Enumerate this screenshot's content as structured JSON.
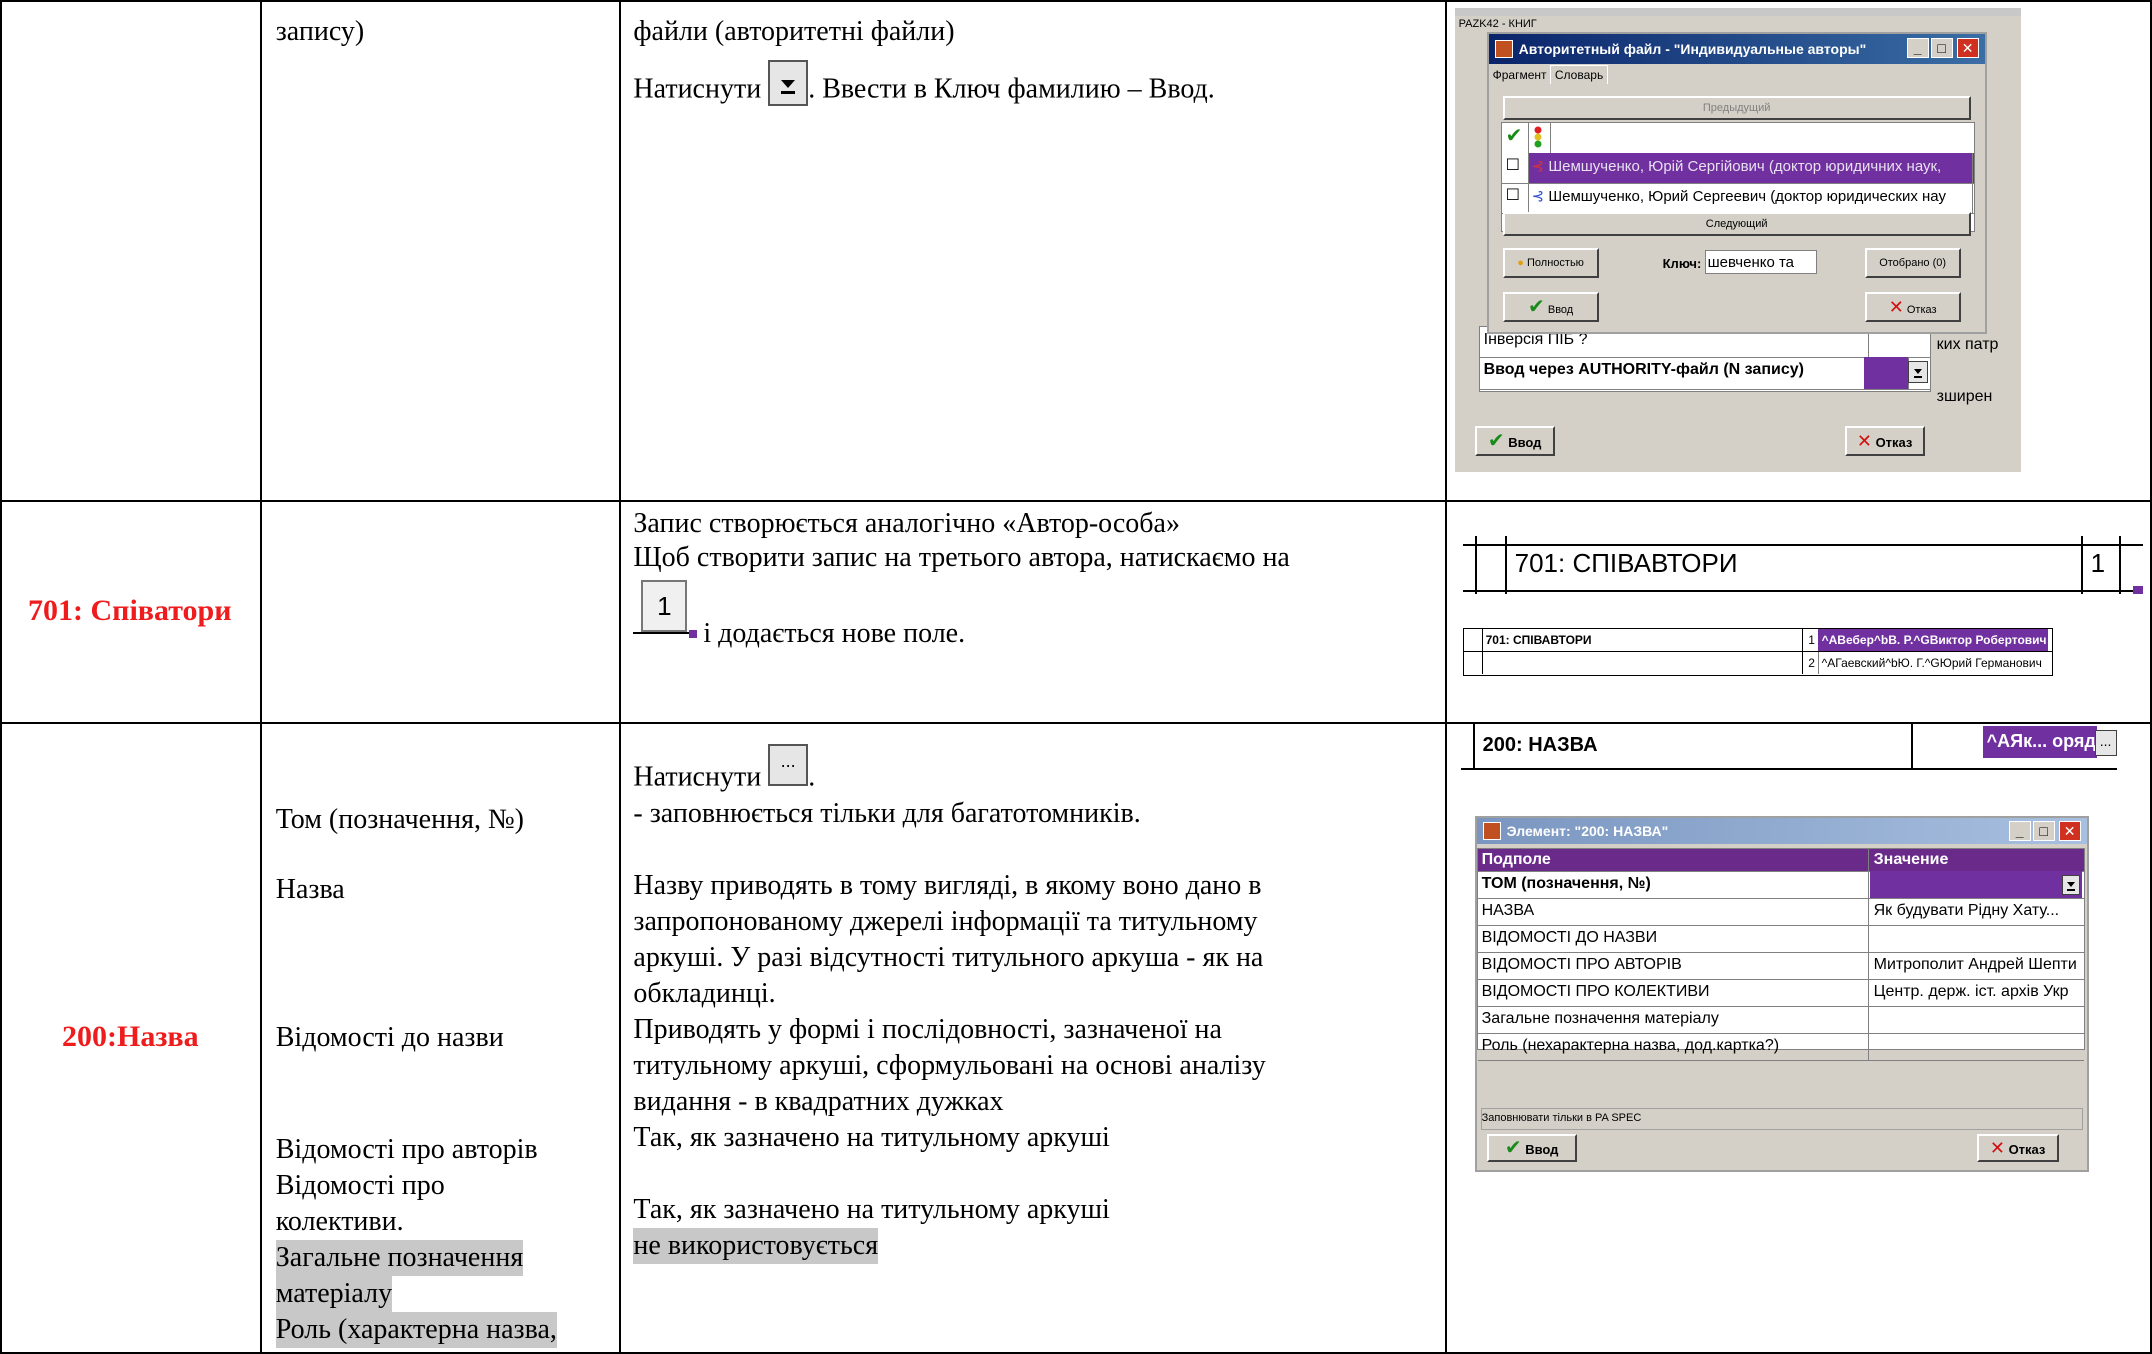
{
  "rows": [
    {
      "field": "",
      "sub": [
        "запису)"
      ],
      "desc": [
        "файли (авторитетні файли)",
        "Натиснути",
        ". Ввести в Ключ фамилию – Ввод."
      ]
    },
    {
      "field": "701: Співатори",
      "desc": [
        "Запис створюється аналогічно «Автор-особа»",
        "Щоб створити запис на третього автора, натискаємо на",
        "1",
        "і додається нове поле."
      ]
    },
    {
      "field": "200:Назва",
      "sub": [
        "Том (позначення, №)",
        "Назва",
        "Відомості до назви",
        "Відомості про авторів",
        "Відомості про",
        "колективи.",
        "Загальне позначення",
        "матеріалу",
        "Роль (характерна назва,"
      ],
      "desc": [
        "Натиснути",
        ".",
        "- заповнюється тільки для багатотомників.",
        "Назву приводять в тому вигляді, в якому воно дано в",
        "запропонованому  джерелі інформації та титульному",
        "аркуші. У разі відсутності титульного аркуша - як на",
        "обкладинці.",
        "Приводять у формі і послідовності, зазначеної на",
        "титульному аркуші, сформульовані на основі аналізу",
        "видання - в квадратних дужках",
        "Так, як зазначено на титульному аркуші",
        "Так, як зазначено на титульному аркуші",
        "не використовується"
      ]
    }
  ],
  "auth_window": {
    "bg_title": "PAZK42 - КНИГ",
    "title": "Авторитетный файл - \"Индивидуальные авторы\"",
    "tabs": [
      "Фрагмент",
      "Словарь"
    ],
    "prev": "Предыдущий",
    "next": "Следующий",
    "items": [
      "Шемшученко, Юрій Сергійович (доктор юридичних наук,",
      "Шемшученко, Юрий Сергеевич (доктор юридических нау"
    ],
    "full_btn": "Полностью",
    "key_label": "Ключ:",
    "key_value": "шевченко та",
    "selected_btn": "Отобрано (0)",
    "ok": "Ввод",
    "cancel": "Отказ",
    "bg_rows": [
      "Інверсія ПІБ ?",
      "Ввод через AUTHORITY-файл (N запису)"
    ],
    "bg_side": [
      "ких патр",
      "зширен"
    ],
    "bg_ok": "Ввод",
    "bg_cancel": "Отказ"
  },
  "coauthors": {
    "big_label": "701: СПІВАВТОРИ",
    "big_num": "1",
    "small_label": "701: СПІВАВТОРИ",
    "small_rows": [
      {
        "num": "1",
        "value": "^AВебер^bB. P.^GВиктор Робертович"
      },
      {
        "num": "2",
        "value": "^AГаевский^bЮ. Г.^GЮрий Германович"
      }
    ]
  },
  "title_field": {
    "label": "200: НАЗВА",
    "value": "^AЯк... оряд. Р.",
    "more": "..."
  },
  "element_window": {
    "title": "Элемент: \"200: НАЗВА\"",
    "col1": "Подполе",
    "col2": "Значение",
    "rows": [
      {
        "name": "ТОМ (позначення, №)",
        "value": ""
      },
      {
        "name": "НАЗВА",
        "value": "Як будувати Рідну Хату..."
      },
      {
        "name": "ВІДОМОСТІ ДО НАЗВИ",
        "value": ""
      },
      {
        "name": "ВІДОМОСТІ ПРО АВТОРІВ",
        "value": "Митрополит Андрей Шепти"
      },
      {
        "name": "ВІДОМОСТІ ПРО КОЛЕКТИВИ",
        "value": "Центр. держ. іст. архів Укр"
      },
      {
        "name": "Загальне позначення матеріалу",
        "value": ""
      },
      {
        "name": "Роль (нехарактерна назва, дод.картка?)",
        "value": ""
      }
    ],
    "hint": "Заповнювати тільки в PA SPEC",
    "ok": "Ввод",
    "cancel": "Отказ"
  }
}
